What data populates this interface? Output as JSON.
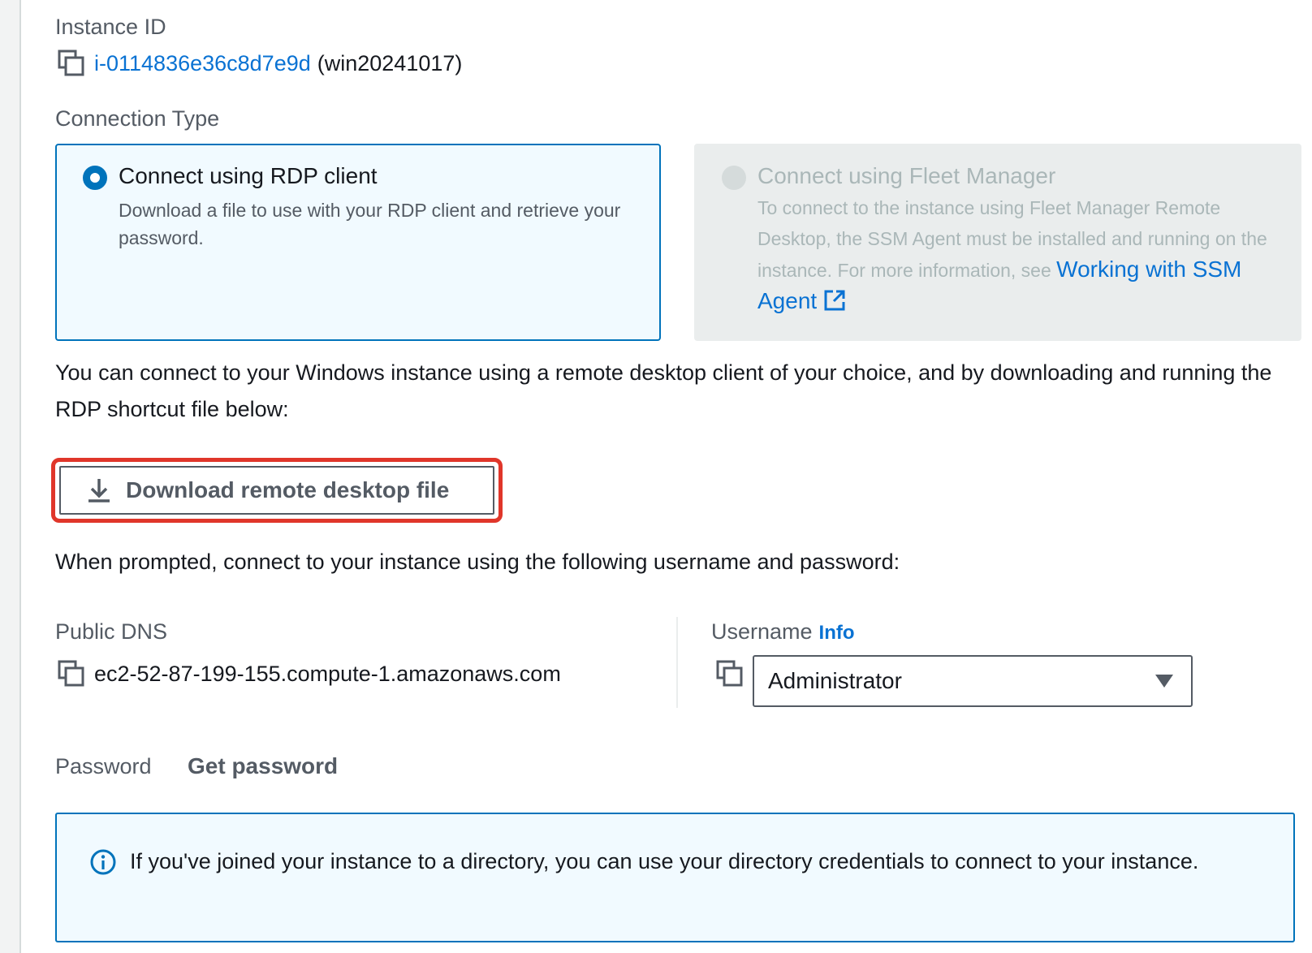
{
  "instance": {
    "label": "Instance ID",
    "id": "i-0114836e36c8d7e9d",
    "name": "(win20241017)"
  },
  "connection_type": {
    "label": "Connection Type",
    "options": [
      {
        "title": "Connect using RDP client",
        "description": "Download a file to use with your RDP client and retrieve your password.",
        "selected": true
      },
      {
        "title": "Connect using Fleet Manager",
        "description": "To connect to the instance using Fleet Manager Remote Desktop, the SSM Agent must be installed and running on the instance. For more information, see",
        "link_text": "Working with SSM Agent",
        "selected": false,
        "disabled": true
      }
    ]
  },
  "intro_text": "You can connect to your Windows instance using a remote desktop client of your choice, and by downloading and running the RDP shortcut file below:",
  "download_button": {
    "label": "Download remote desktop file"
  },
  "prompt_text": "When prompted, connect to your instance using the following username and password:",
  "public_dns": {
    "label": "Public DNS",
    "value": "ec2-52-87-199-155.compute-1.amazonaws.com"
  },
  "username": {
    "label": "Username",
    "info_link": "Info",
    "selected": "Administrator"
  },
  "password": {
    "label": "Password",
    "action": "Get password"
  },
  "alert": {
    "text": "If you've joined your instance to a directory, you can use your directory credentials to connect to your instance."
  },
  "colors": {
    "accent": "#0073bb",
    "link": "#0972d3",
    "highlight": "#e0362a"
  },
  "icons": [
    "copy-icon",
    "external-link-icon",
    "download-icon",
    "info-icon",
    "caret-down-icon"
  ]
}
